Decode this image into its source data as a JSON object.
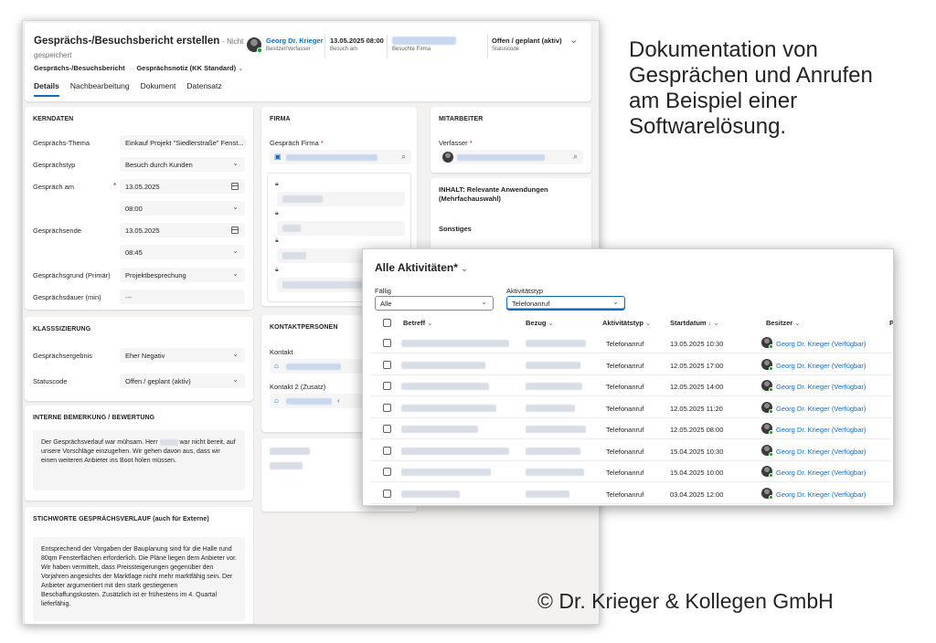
{
  "header": {
    "title": "Gesprächs-/Besuchsbericht erstellen",
    "save_state_1": "- Nicht",
    "save_state_2": "gespeichert",
    "form_type": "Gesprächs-/Besuchsbericht",
    "form_view": "Gesprächsnotiz (KK Standard)",
    "owner_name": "Georg Dr. Krieger",
    "owner_label": "Besitzer/Verfasser",
    "visit_date": "13.05.2025 08:00",
    "visit_label": "Besuch am",
    "company_label": "Besuchte Firma",
    "status_value": "Offen / geplant (aktiv)",
    "status_label": "Statuscode",
    "tabs": [
      "Details",
      "Nachbearbeitung",
      "Dokument",
      "Datensatz"
    ]
  },
  "kerndaten": {
    "title": "KERNDATEN",
    "fields": [
      {
        "label": "Gesprächs-Thema",
        "value": "Einkauf Projekt \"Siedlerstraße\" Fenst..."
      },
      {
        "label": "Gesprächstyp",
        "value": "Besuch durch Kunden"
      },
      {
        "label": "Gespräch am",
        "date": "13.05.2025",
        "time": "08:00"
      },
      {
        "label": "Gesprächsende",
        "date": "13.05.2025",
        "time": "08:45"
      },
      {
        "label": "Gesprächsgrund (Primär)",
        "value": "Projektbesprechung"
      },
      {
        "label": "Gesprächsdauer (min)",
        "value": "---"
      }
    ]
  },
  "klassifizierung": {
    "title": "KLASSSIZIERUNG",
    "fields": [
      {
        "label": "Gesprächsergebnis",
        "value": "Eher Negativ"
      },
      {
        "label": "Statuscode",
        "value": "Offen / geplant (aktiv)"
      }
    ]
  },
  "bemerkung": {
    "title": "INTERNE BEMERKUNG / BEWERTUNG",
    "text_1": "Der Gesprächsverlauf war mühsam. Herr",
    "text_2": "war nicht bereit, auf unsere Vorschläge einzugehen. Wir gehen davon aus, dass wir einen weiteren Anbieter ins Boot holen müssen."
  },
  "stichworte": {
    "title": "STICHWORTE GESPRÄCHSVERLAUF (auch für Externe)",
    "text": "Entsprechend der Vorgaben der Bauplanung sind für die Halle rund 80qm Fensterflächen erforderlich. Die Pläne liegen dem Anbieter vor. Wir haben vermittelt, dass Preissteigerungen gegenüber den Vorjahren angesichts der Marktlage nicht mehr marktfähig sein. Der Anbieter argumentiert mit den stark gestiegenen Beschaffungskosten. Zusätzlich ist er frühestens im 4. Quartal lieferfähig."
  },
  "firma": {
    "title": "FIRMA",
    "field_label": "Gespräch Firma"
  },
  "kontakt": {
    "title": "KONTAKTPERSONEN",
    "contact_label": "Kontakt",
    "contact2_label": "Kontakt 2 (Zusatz)"
  },
  "mitarbeiter": {
    "title": "MITARBEITER",
    "author_label": "Verfasser"
  },
  "inhalt": {
    "title": "INHALT: Relevante Anwendungen (Mehrfachauswahl)",
    "other_label": "Sonstiges"
  },
  "activities": {
    "title": "Alle Aktivitäten*",
    "filter_due_label": "Fällig",
    "filter_due_value": "Alle",
    "filter_type_label": "Aktivitätstyp",
    "filter_type_value": "Telefonanruf",
    "columns": [
      "Betreff",
      "Bezug",
      "Aktivitätstyp",
      "Startdatum",
      "Besitzer",
      "P"
    ],
    "rows": [
      {
        "type": "Telefonanruf",
        "start": "13.05.2025 10:30",
        "owner": "Georg Dr. Krieger (Verfügbar)"
      },
      {
        "type": "Telefonanruf",
        "start": "12.05.2025 17:00",
        "owner": "Georg Dr. Krieger (Verfügbar)"
      },
      {
        "type": "Telefonanruf",
        "start": "12.05.2025 14:00",
        "owner": "Georg Dr. Krieger (Verfügbar)"
      },
      {
        "type": "Telefonanruf",
        "start": "12.05.2025 11:20",
        "owner": "Georg Dr. Krieger (Verfügbar)"
      },
      {
        "type": "Telefonanruf",
        "start": "12.05.2025 08:00",
        "owner": "Georg Dr. Krieger (Verfügbar)"
      },
      {
        "type": "Telefonanruf",
        "start": "15.04.2025 10:30",
        "owner": "Georg Dr. Krieger (Verfügbar)"
      },
      {
        "type": "Telefonanruf",
        "start": "15.04.2025 10:00",
        "owner": "Georg Dr. Krieger (Verfügbar)"
      },
      {
        "type": "Telefonanruf",
        "start": "03.04.2025 12:00",
        "owner": "Georg Dr. Krieger (Verfügbar)"
      }
    ]
  },
  "caption": {
    "line_1": "Dokumentation von",
    "line_2": "Gesprächen und Anrufen",
    "line_3": "am Beispiel einer",
    "line_4": "Softwarelösung.",
    "copyright": "© Dr. Krieger & Kollegen GmbH"
  },
  "colors": {
    "accent": "#0f6cbd",
    "required": "#c50f1f",
    "presence": "#13a10e"
  }
}
